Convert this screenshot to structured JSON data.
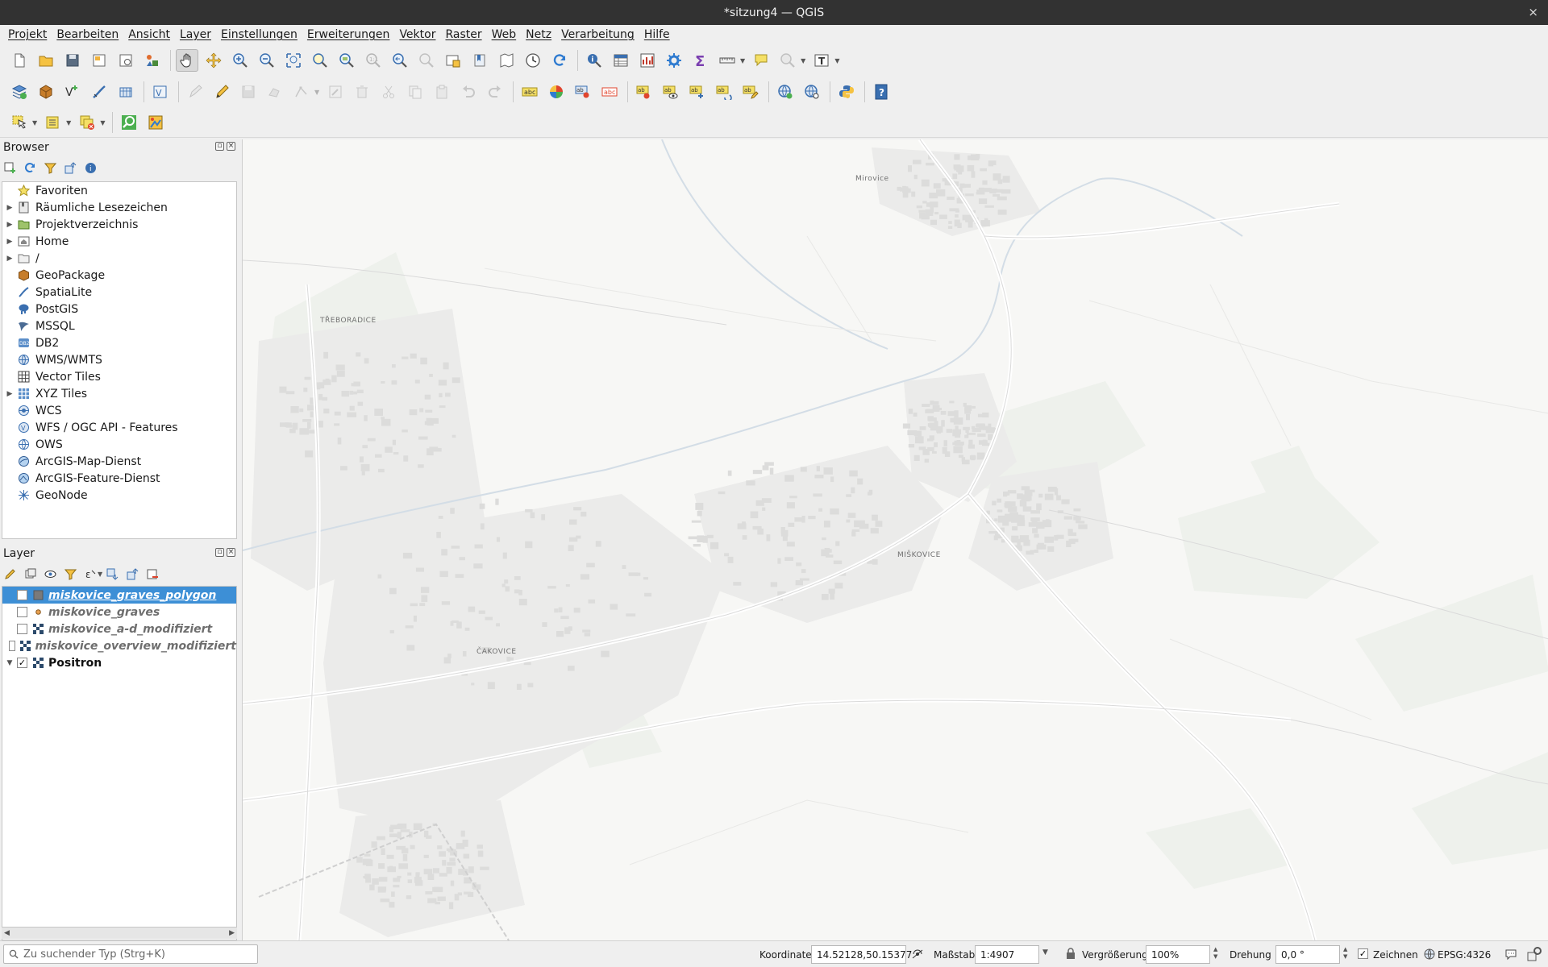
{
  "window": {
    "title": "*sitzung4 — QGIS",
    "close_glyph": "×"
  },
  "menu": [
    "Projekt",
    "Bearbeiten",
    "Ansicht",
    "Layer",
    "Einstellungen",
    "Erweiterungen",
    "Vektor",
    "Raster",
    "Web",
    "Netz",
    "Verarbeitung",
    "Hilfe"
  ],
  "browser": {
    "title": "Browser",
    "items": [
      {
        "label": "Favoriten",
        "icon": "star-icon",
        "expandable": false
      },
      {
        "label": "Räumliche Lesezeichen",
        "icon": "bookmark-icon",
        "expandable": true
      },
      {
        "label": "Projektverzeichnis",
        "icon": "project-folder-icon",
        "expandable": true
      },
      {
        "label": "Home",
        "icon": "home-folder-icon",
        "expandable": true
      },
      {
        "label": "/",
        "icon": "folder-icon",
        "expandable": true
      },
      {
        "label": "GeoPackage",
        "icon": "geopackage-icon",
        "expandable": false
      },
      {
        "label": "SpatiaLite",
        "icon": "spatialite-icon",
        "expandable": false
      },
      {
        "label": "PostGIS",
        "icon": "postgis-icon",
        "expandable": false
      },
      {
        "label": "MSSQL",
        "icon": "mssql-icon",
        "expandable": false
      },
      {
        "label": "DB2",
        "icon": "db2-icon",
        "expandable": false
      },
      {
        "label": "WMS/WMTS",
        "icon": "wms-icon",
        "expandable": false
      },
      {
        "label": "Vector Tiles",
        "icon": "vector-tiles-icon",
        "expandable": false
      },
      {
        "label": "XYZ Tiles",
        "icon": "xyz-tiles-icon",
        "expandable": true
      },
      {
        "label": "WCS",
        "icon": "wcs-icon",
        "expandable": false
      },
      {
        "label": "WFS / OGC API - Features",
        "icon": "wfs-icon",
        "expandable": false
      },
      {
        "label": "OWS",
        "icon": "ows-icon",
        "expandable": false
      },
      {
        "label": "ArcGIS-Map-Dienst",
        "icon": "arcgis-map-icon",
        "expandable": false
      },
      {
        "label": "ArcGIS-Feature-Dienst",
        "icon": "arcgis-feature-icon",
        "expandable": false
      },
      {
        "label": "GeoNode",
        "icon": "geonode-icon",
        "expandable": false
      }
    ]
  },
  "layers": {
    "title": "Layer",
    "items": [
      {
        "label": "miskovice_graves_polygon",
        "checked": false,
        "selected": true,
        "type": "polygon"
      },
      {
        "label": "miskovice_graves",
        "checked": false,
        "selected": false,
        "type": "point"
      },
      {
        "label": "miskovice_a-d_modifiziert",
        "checked": false,
        "selected": false,
        "type": "raster"
      },
      {
        "label": "miskovice_overview_modifiziert",
        "checked": false,
        "selected": false,
        "type": "raster"
      },
      {
        "label": "Positron",
        "checked": true,
        "selected": false,
        "type": "raster"
      }
    ]
  },
  "map": {
    "labels": [
      "Mirovice",
      "TŘEBORADICE",
      "MIŠKOVICE",
      "ČAKOVICE"
    ]
  },
  "status": {
    "locator_placeholder": "Zu suchender Typ (Strg+K)",
    "coord_label": "Koordinate",
    "coord_value": "14.52128,50.15377",
    "scale_label": "Maßstab",
    "scale_value": "1:4907",
    "magnifier_label": "Vergrößerung",
    "magnifier_value": "100%",
    "rotation_label": "Drehung",
    "rotation_value": "0,0 °",
    "render_label": "Zeichnen",
    "crs": "EPSG:4326"
  },
  "colors": {
    "accent": "#3d8fd6",
    "titlebar": "#323232",
    "map_bg": "#f7f7f5"
  }
}
